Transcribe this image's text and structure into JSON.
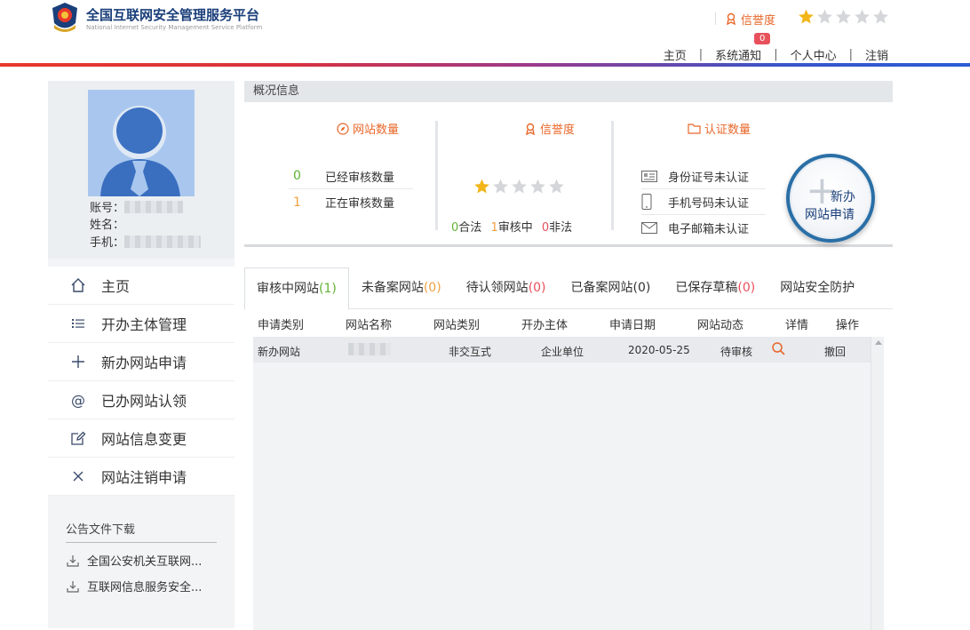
{
  "brand": {
    "title": "全国互联网安全管理服务平台",
    "subtitle": "National Internet Security Management Service Platform"
  },
  "header": {
    "credit_label": "信誉度",
    "credit_stars": 1,
    "credit_max": 5,
    "notice_badge": "0",
    "nav": [
      "主页",
      "系统通知",
      "个人中心",
      "注销"
    ]
  },
  "profile": {
    "account_label": "账号：",
    "name_label": "姓名：",
    "phone_label": "手机："
  },
  "menu": [
    {
      "label": "主页",
      "icon": "home-icon"
    },
    {
      "label": "开办主体管理",
      "icon": "list-icon"
    },
    {
      "label": "新办网站申请",
      "icon": "plus-icon"
    },
    {
      "label": "已办网站认领",
      "icon": "at-icon"
    },
    {
      "label": "网站信息变更",
      "icon": "edit-icon"
    },
    {
      "label": "网站注销申请",
      "icon": "close-icon"
    }
  ],
  "downloads": {
    "title": "公告文件下载",
    "items": [
      "全国公安机关互联网...",
      "互联网信息服务安全..."
    ]
  },
  "overview": {
    "title": "概况信息",
    "site_count": {
      "title": "网站数量",
      "rows": [
        {
          "num": "0",
          "label": "已经审核数量",
          "color": "#5fb233"
        },
        {
          "num": "1",
          "label": "正在审核数量",
          "color": "#f0a040"
        }
      ]
    },
    "credit": {
      "title": "信誉度",
      "stars": 1,
      "legal_num": "0",
      "legal_label": "合法",
      "review_num": "1",
      "review_label": "审核中",
      "illegal_num": "0",
      "illegal_label": "非法"
    },
    "cert": {
      "title": "认证数量",
      "rows": [
        {
          "label": "身份证号未认证",
          "icon": "id-card-icon"
        },
        {
          "label": "手机号码未认证",
          "icon": "phone-icon"
        },
        {
          "label": "电子邮箱未认证",
          "icon": "mail-icon"
        }
      ]
    },
    "new_button": {
      "line1": "新办",
      "line2": "网站申请"
    }
  },
  "tabs": [
    {
      "label": "审核中网站",
      "count": "(1)",
      "count_class": "cnt-g"
    },
    {
      "label": "未备案网站",
      "count": "(0)",
      "count_class": "cnt-o"
    },
    {
      "label": "待认领网站",
      "count": "(0)",
      "count_class": "cnt-r"
    },
    {
      "label": "已备案网站",
      "count": "(0)",
      "count_class": ""
    },
    {
      "label": "已保存草稿",
      "count": "(0)",
      "count_class": "cnt-r"
    },
    {
      "label": "网站安全防护",
      "count": "",
      "count_class": ""
    }
  ],
  "table": {
    "headers": [
      "申请类别",
      "网站名称",
      "网站类别",
      "开办主体",
      "申请日期",
      "网站动态",
      "详情",
      "操作"
    ],
    "rows": [
      {
        "type": "新办网站",
        "name": "",
        "category": "非交互式",
        "entity": "企业单位",
        "date": "2020-05-25",
        "status": "待审核",
        "detail_icon": "search-icon",
        "action": "撤回"
      }
    ]
  },
  "colors": {
    "accent_orange": "#e8672a",
    "navy": "#1a3f7a",
    "green": "#5fb233",
    "orange": "#f0a040",
    "red": "#e8505b"
  }
}
